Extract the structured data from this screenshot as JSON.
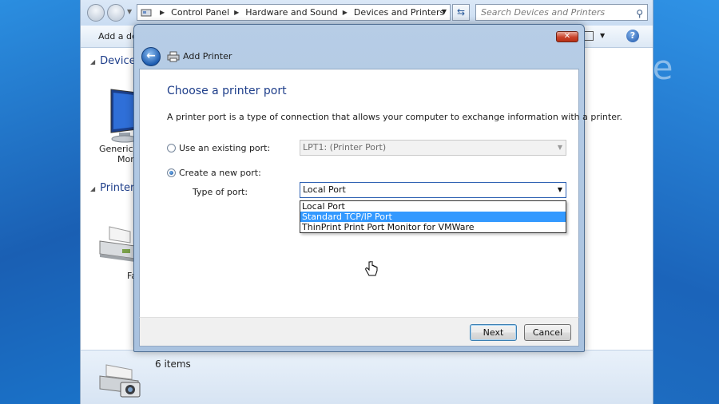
{
  "explorer": {
    "breadcrumbs": [
      "Control Panel",
      "Hardware and Sound",
      "Devices and Printers"
    ],
    "search_placeholder": "Search Devices and Printers",
    "toolbar_add": "Add a dev",
    "groups": {
      "devices": "Devices",
      "printers": "Printers"
    },
    "devices": {
      "monitor_label_line1": "Generic N",
      "monitor_label_line2": "Mon"
    },
    "printers": {
      "fax_label": "Fa"
    },
    "status": {
      "count": "6 items"
    }
  },
  "watermark": {
    "text": "peter    live"
  },
  "dialog": {
    "title": "Add Printer",
    "close_glyph": "✕",
    "heading": "Choose a printer port",
    "description": "A printer port is a type of connection that allows your computer to exchange information with a printer.",
    "existing_port_label": "Use an existing port:",
    "existing_port_value": "LPT1: (Printer Port)",
    "new_port_label": "Create a new port:",
    "type_of_port_label": "Type of port:",
    "type_of_port_value": "Local Port",
    "selected_radio": "new_port",
    "dropdown_options": [
      "Local Port",
      "Standard TCP/IP Port",
      "ThinPrint Print Port Monitor for VMWare"
    ],
    "highlighted_option_index": 1,
    "buttons": {
      "next": "Next",
      "cancel": "Cancel"
    }
  },
  "colors": {
    "heading": "#1e3e8a",
    "highlight": "#3399ff",
    "desktop": "#1f6fc5"
  }
}
